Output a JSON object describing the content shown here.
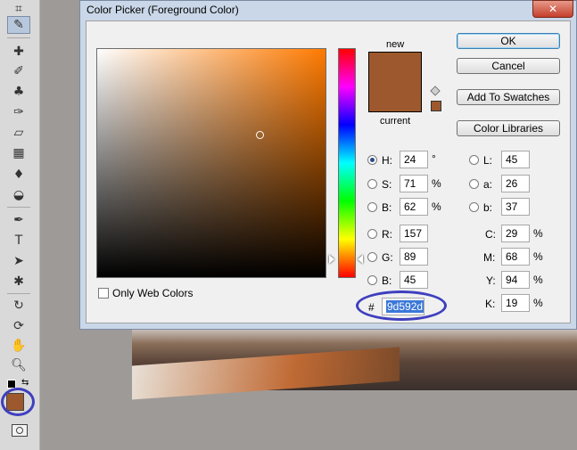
{
  "dialog": {
    "title": "Color Picker (Foreground Color)",
    "close_glyph": "✕"
  },
  "swatches": {
    "new_label": "new",
    "current_label": "current",
    "new_color": "#9d592d",
    "current_color": "#9d592d"
  },
  "buttons": {
    "ok": "OK",
    "cancel": "Cancel",
    "add_to_swatches": "Add To Swatches",
    "color_libraries": "Color Libraries"
  },
  "hsb": {
    "h_label": "H:",
    "h_value": "24",
    "h_unit": "°",
    "s_label": "S:",
    "s_value": "71",
    "s_unit": "%",
    "b_label": "B:",
    "b_value": "62",
    "b_unit": "%"
  },
  "rgb": {
    "r_label": "R:",
    "r_value": "157",
    "g_label": "G:",
    "g_value": "89",
    "b_label": "B:",
    "b_value": "45"
  },
  "lab": {
    "l_label": "L:",
    "l_value": "45",
    "a_label": "a:",
    "a_value": "26",
    "b_label": "b:",
    "b_value": "37"
  },
  "cmyk": {
    "c_label": "C:",
    "c_value": "29",
    "m_label": "M:",
    "m_value": "68",
    "y_label": "Y:",
    "y_value": "94",
    "k_label": "K:",
    "k_value": "19",
    "unit": "%"
  },
  "hex": {
    "label": "#",
    "value": "9d592d"
  },
  "options": {
    "only_web_colors": "Only Web Colors"
  },
  "toolbar": {
    "foreground_color": "#9d592d",
    "background_color": "#ffffff",
    "highlight_color": "#3f3fbf"
  }
}
